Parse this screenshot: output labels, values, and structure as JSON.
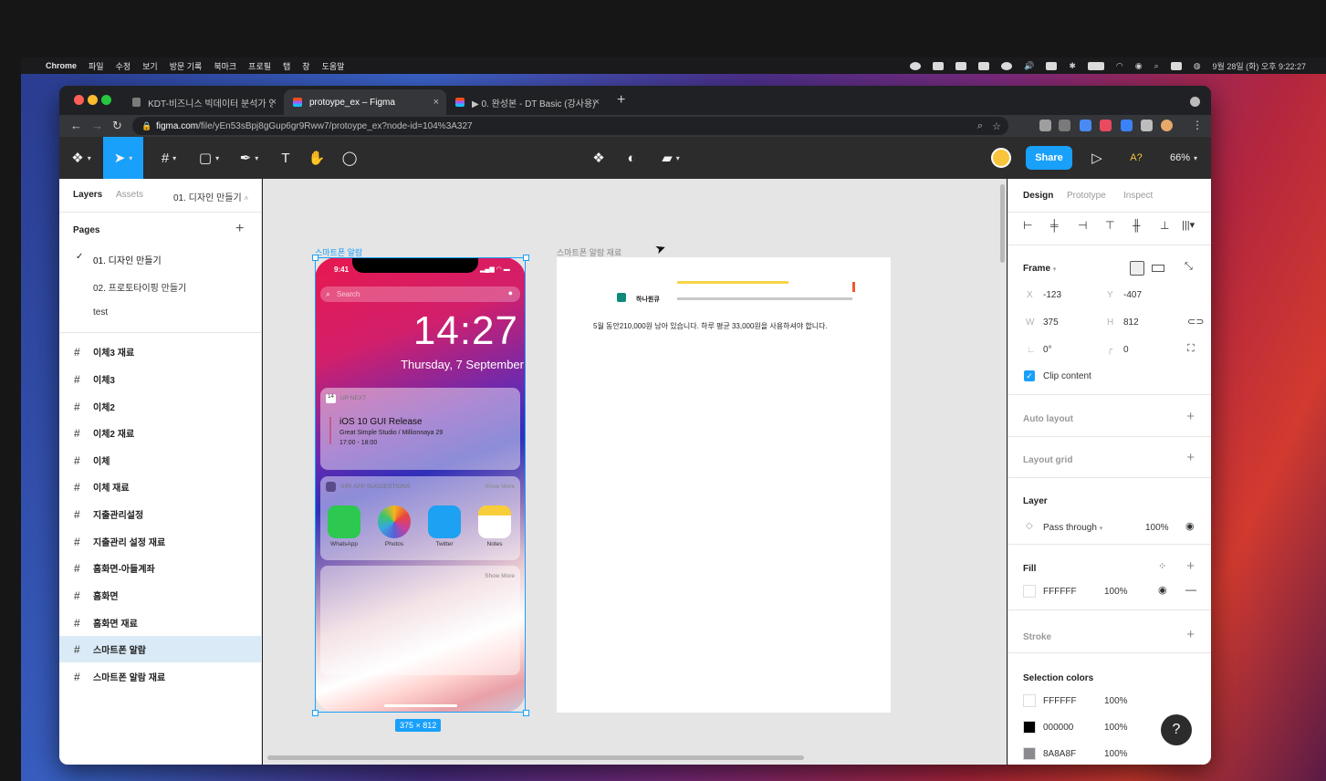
{
  "menubar": {
    "app": "Chrome",
    "items": [
      "파일",
      "수정",
      "보기",
      "방문 기록",
      "북마크",
      "프로필",
      "탭",
      "창",
      "도움말"
    ],
    "datetime": "9월 28일 (화) 오후 9:22:27"
  },
  "tabs": [
    {
      "label": "KDT-비즈니스 빅데이터 분석가 양성",
      "active": false
    },
    {
      "label": "protoype_ex – Figma",
      "active": true
    },
    {
      "label": "▶ 0. 완성본 - DT Basic (강사용)",
      "active": false
    }
  ],
  "address": {
    "host": "figma.com",
    "path": "/file/yEn53sBpj8gGup6gr9Rww7/protoype_ex?node-id=104%3A327"
  },
  "toolbar": {
    "share_label": "Share",
    "zoom_label": "66%",
    "font_warning": "A?"
  },
  "left": {
    "tab_layers": "Layers",
    "tab_assets": "Assets",
    "current_page": "01. 디자인 만들기",
    "pages_label": "Pages",
    "pages": [
      "01. 디자인 만들기",
      "02. 프로토타이핑 만들기",
      "test"
    ],
    "layers": [
      "이체3 재료",
      "이체3",
      "이체2",
      "이체2 재료",
      "이체",
      "이체 재료",
      "지출관리설정",
      "지출관리 설정 재료",
      "홈화면-아들계좌",
      "홈화면",
      "홈화면 재료",
      "스마트폰 알람",
      "스마트폰 알람 재료"
    ],
    "selected_layer": "스마트폰 알람"
  },
  "canvas": {
    "frame1_label": "스마트폰 알람",
    "frame2_label": "스마트폰 알람 재료",
    "size_badge": "375 × 812",
    "phone": {
      "status_time": "9:41",
      "search_placeholder": "Search",
      "clock": "14:27",
      "date": "Thursday, 7 September",
      "upnext_day": "14",
      "upnext_label": "UP NEXT",
      "event_title": "iOS 10 GUI Release",
      "event_place": "Great Simple Studio / Millionnaya 29",
      "event_time": "17:00 - 18:00",
      "siri_label": "SIRI APP SUGGESTIONS",
      "show_more": "Show More",
      "apps": [
        "WhatsApp",
        "Photos",
        "Twitter",
        "Notes"
      ]
    },
    "material": {
      "bank_name": "하나원큐",
      "message": "5월 동안210,000원 남아 있습니다. 하루 평균 33,000원을 사용하셔야 합니다."
    }
  },
  "right": {
    "tab_design": "Design",
    "tab_prototype": "Prototype",
    "tab_inspect": "Inspect",
    "frame_label": "Frame",
    "x_label": "X",
    "x": "-123",
    "y_label": "Y",
    "y": "-407",
    "w_label": "W",
    "w": "375",
    "h_label": "H",
    "h": "812",
    "rotation": "0°",
    "radius": "0",
    "clip_label": "Clip content",
    "auto_layout": "Auto layout",
    "layout_grid": "Layout grid",
    "layer_label": "Layer",
    "blend": "Pass through",
    "layer_opacity": "100%",
    "fill_label": "Fill",
    "fill_hex": "FFFFFF",
    "fill_opacity": "100%",
    "stroke_label": "Stroke",
    "selection_colors_label": "Selection colors",
    "selection_colors": [
      {
        "hex": "FFFFFF",
        "opacity": "100%",
        "color": "#FFFFFF"
      },
      {
        "hex": "000000",
        "opacity": "100%",
        "color": "#000000"
      },
      {
        "hex": "8A8A8F",
        "opacity": "100%",
        "color": "#8A8A8F"
      }
    ]
  },
  "colors": {
    "accent": "#18A0FB",
    "toolbar": "#2C2C2C",
    "selection": "#DAEBF7"
  }
}
